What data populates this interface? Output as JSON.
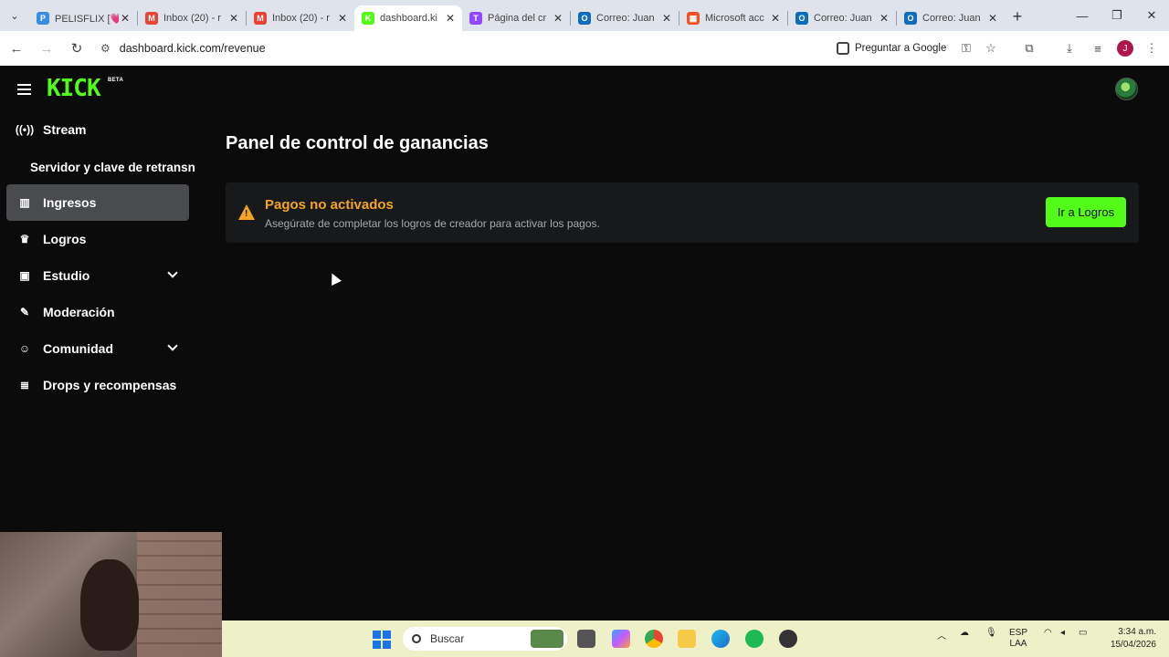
{
  "browser": {
    "tabs": [
      {
        "title": "PELISFLIX [💗",
        "fav_color": "#3a8dde",
        "fav_letter": "P"
      },
      {
        "title": "Inbox (20) - r",
        "fav_color": "#ea4335",
        "fav_letter": "M"
      },
      {
        "title": "Inbox (20) - r",
        "fav_color": "#ea4335",
        "fav_letter": "M"
      },
      {
        "title": "dashboard.ki",
        "fav_color": "#53fc18",
        "fav_letter": "K"
      },
      {
        "title": "Página del cr",
        "fav_color": "#9146ff",
        "fav_letter": "T"
      },
      {
        "title": "Correo: Juan",
        "fav_color": "#0f6cbd",
        "fav_letter": "O"
      },
      {
        "title": "Microsoft acc",
        "fav_color": "#f25022",
        "fav_letter": "▦"
      },
      {
        "title": "Correo: Juan",
        "fav_color": "#0f6cbd",
        "fav_letter": "O"
      },
      {
        "title": "Correo: Juan",
        "fav_color": "#0f6cbd",
        "fav_letter": "O"
      }
    ],
    "url": "dashboard.kick.com/revenue",
    "ask_google": "Preguntar a Google",
    "profile_initial": "J"
  },
  "kick": {
    "logo": "KICK",
    "beta": "BETA",
    "sidebar": {
      "items": [
        {
          "label": "Stream",
          "icon": "broadcast-icon"
        },
        {
          "label": "Ingresos",
          "icon": "chart-icon"
        },
        {
          "label": "Logros",
          "icon": "trophy-icon"
        },
        {
          "label": "Estudio",
          "icon": "studio-icon"
        },
        {
          "label": "Moderación",
          "icon": "wrench-icon"
        },
        {
          "label": "Comunidad",
          "icon": "community-icon"
        },
        {
          "label": "Drops y recompensas",
          "icon": "drops-icon"
        }
      ],
      "sub_item": "Servidor y clave de retransn"
    },
    "page_title": "Panel de control de ganancias",
    "alert": {
      "title": "Pagos no activados",
      "description": "Asegúrate de completar los logros de creador para activar los pagos.",
      "button": "Ir a Logros"
    }
  },
  "taskbar": {
    "search_placeholder": "Buscar",
    "lang_top": "ESP",
    "lang_bottom": "LAA",
    "time": "3:34 a.m.",
    "date": "15/04/2026"
  }
}
